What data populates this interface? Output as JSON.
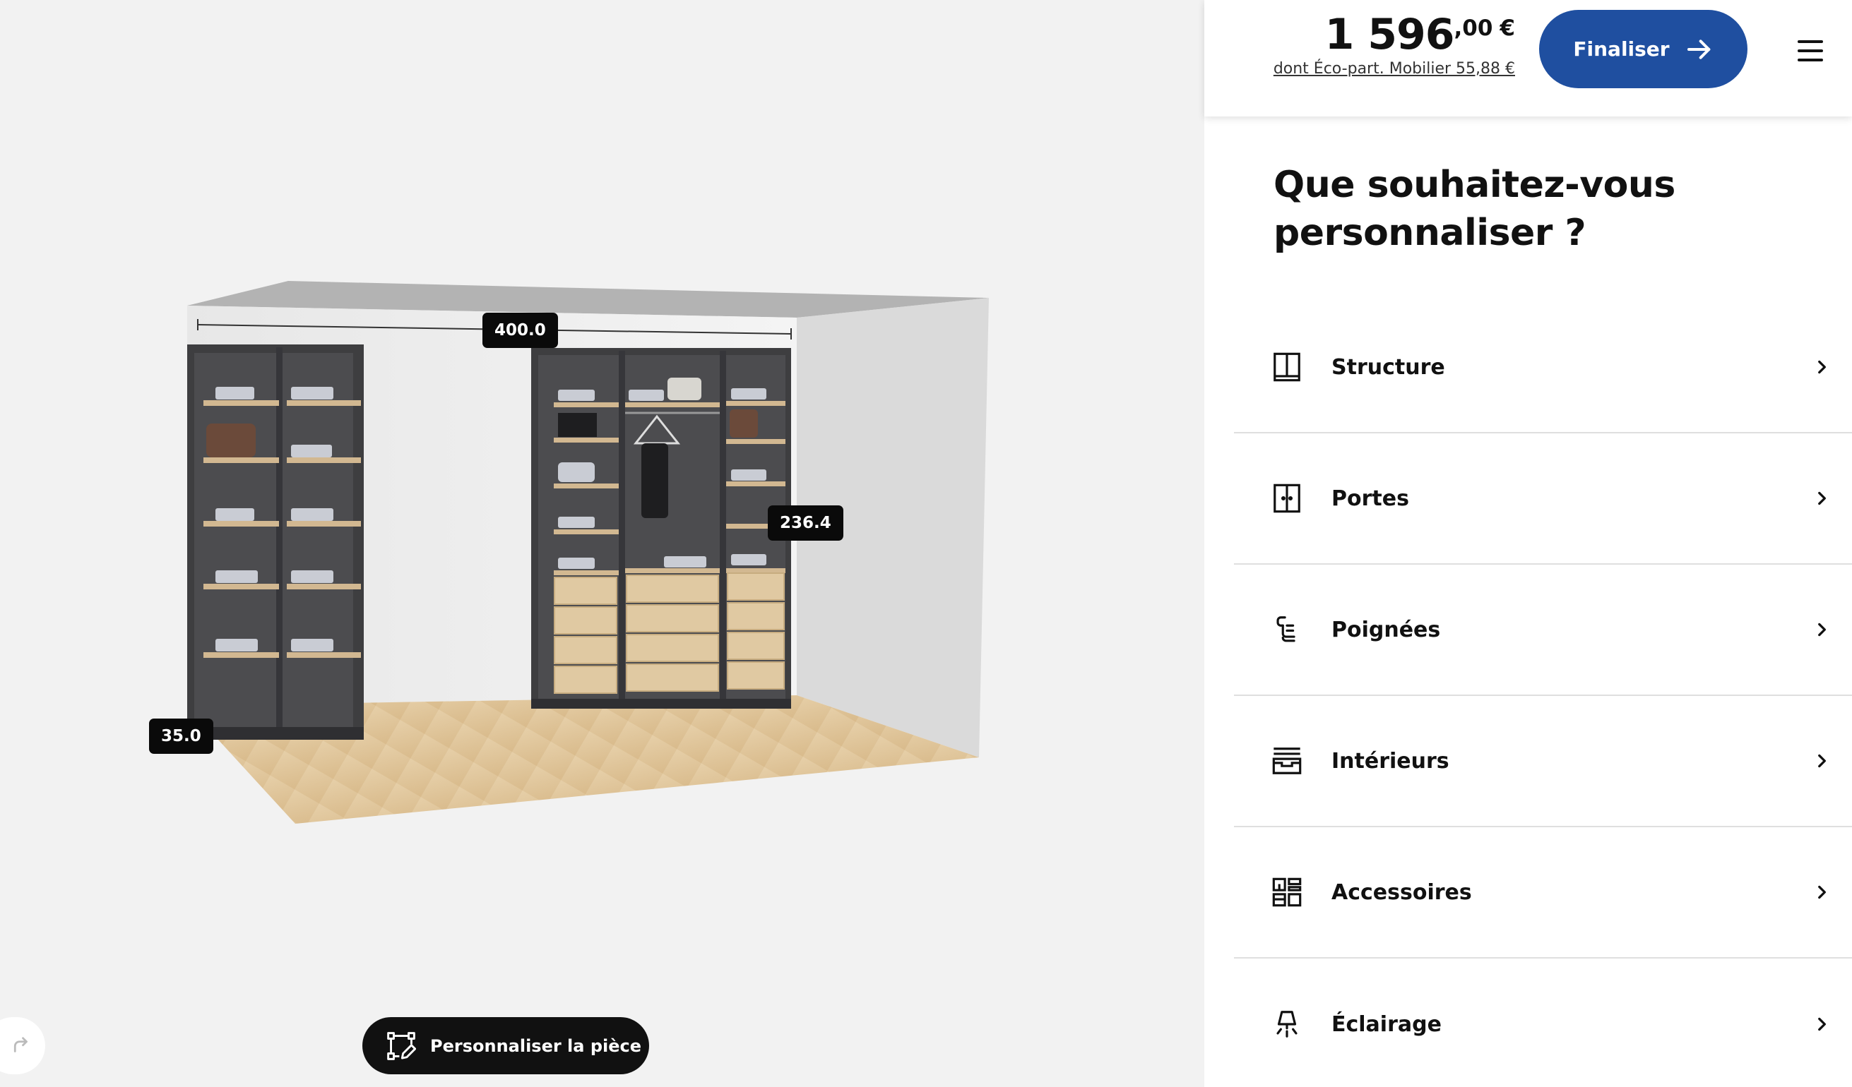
{
  "viewer": {
    "dimensions": {
      "width": "400.0",
      "height": "236.4",
      "depth": "35.0"
    },
    "customize_room_label": "Personnaliser la pièce",
    "icons": {
      "customize": "room-edit-icon",
      "redo": "redo-icon"
    }
  },
  "header": {
    "price_main": "1 596",
    "price_decimals": ",00",
    "price_currency": "€",
    "eco_part": "dont Éco-part. Mobilier 55,88 €",
    "finalize_label": "Finaliser",
    "accent_color": "#1f4fa0"
  },
  "panel": {
    "title": "Que souhaitez-vous personnaliser ?",
    "options": [
      {
        "label": "Structure",
        "icon": "structure-icon"
      },
      {
        "label": "Portes",
        "icon": "doors-icon"
      },
      {
        "label": "Poignées",
        "icon": "handles-icon"
      },
      {
        "label": "Intérieurs",
        "icon": "interiors-icon"
      },
      {
        "label": "Accessoires",
        "icon": "accessories-icon"
      },
      {
        "label": "Éclairage",
        "icon": "lighting-icon"
      }
    ]
  }
}
